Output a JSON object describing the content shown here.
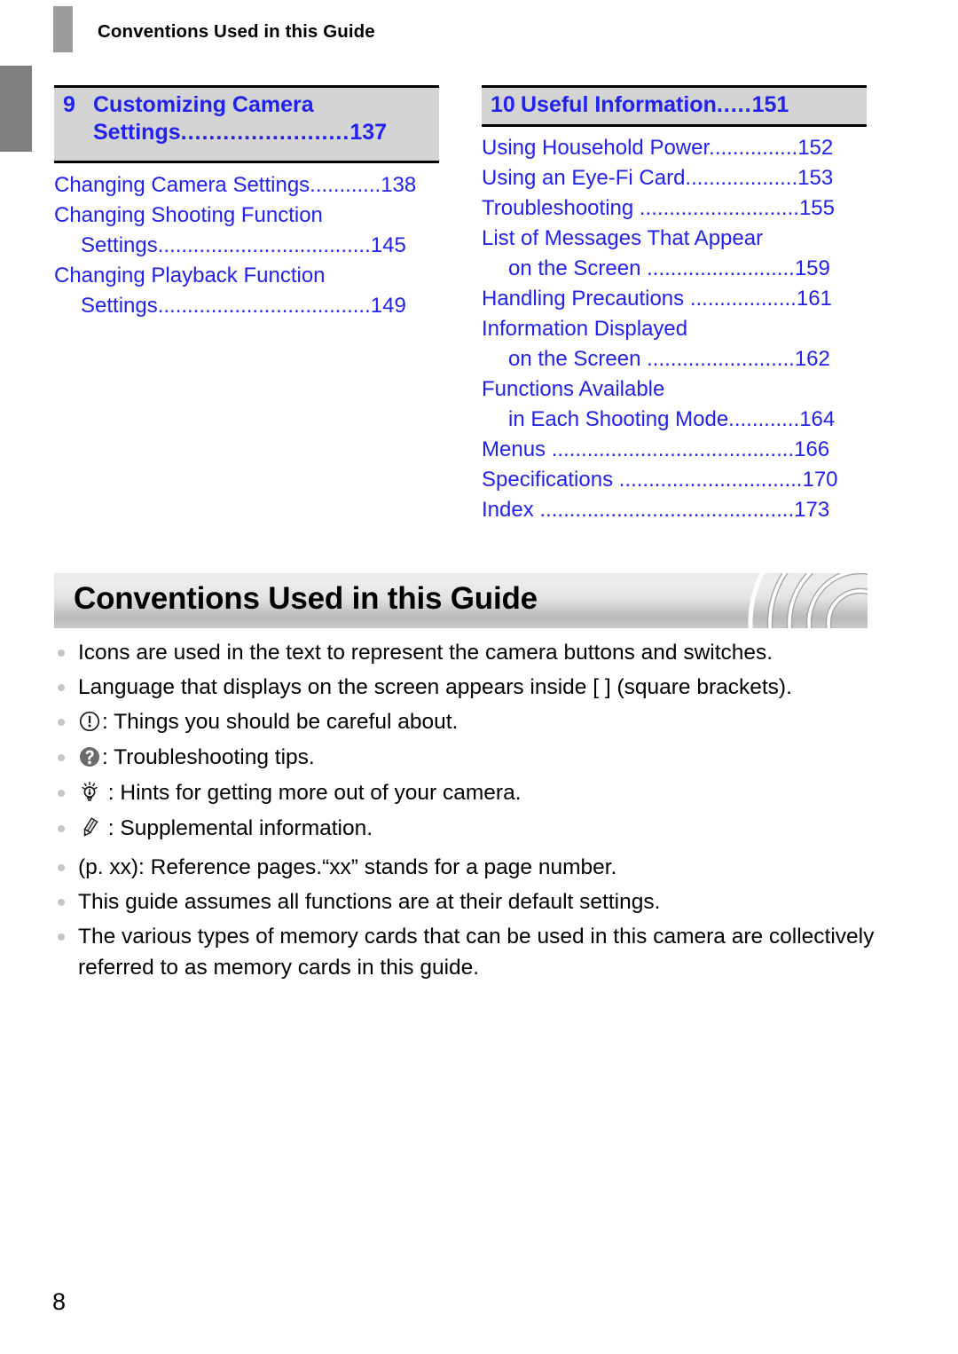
{
  "header": {
    "title": "Conventions Used in this Guide",
    "marker_icon": "chapter-marker-bar"
  },
  "edge_tab": {
    "icon": "chapter-edge-tab"
  },
  "toc": {
    "columns": [
      {
        "chapter": {
          "number": "9",
          "title_line1": "Customizing Camera",
          "title_line2": "Settings",
          "leader": "........................",
          "page": "137"
        },
        "entries": [
          {
            "label": "Changing Camera Settings",
            "leader": "............",
            "page": "138",
            "sub": false
          },
          {
            "label": "Changing Shooting Function",
            "leader": "",
            "page": "",
            "sub": false
          },
          {
            "label": "Settings",
            "leader": "....................................",
            "page": "145",
            "sub": true
          },
          {
            "label": "Changing Playback Function",
            "leader": "",
            "page": "",
            "sub": false
          },
          {
            "label": "Settings",
            "leader": "....................................",
            "page": "149",
            "sub": true
          }
        ]
      },
      {
        "chapter": {
          "number": "10",
          "title_line1": "Useful Information",
          "title_line2": "",
          "leader": ".....",
          "page": "151"
        },
        "entries": [
          {
            "label": "Using Household Power",
            "leader": "...............",
            "page": "152",
            "sub": false
          },
          {
            "label": "Using an Eye-Fi Card",
            "leader": "...................",
            "page": "153",
            "sub": false
          },
          {
            "label": "Troubleshooting ",
            "leader": "...........................",
            "page": "155",
            "sub": false
          },
          {
            "label": "List of Messages That Appear",
            "leader": "",
            "page": "",
            "sub": false
          },
          {
            "label": "on the Screen ",
            "leader": ".........................",
            "page": "159",
            "sub": true
          },
          {
            "label": "Handling Precautions ",
            "leader": "..................",
            "page": "161",
            "sub": false
          },
          {
            "label": "Information Displayed",
            "leader": "",
            "page": "",
            "sub": false
          },
          {
            "label": "on the Screen ",
            "leader": ".........................",
            "page": "162",
            "sub": true
          },
          {
            "label": "Functions Available",
            "leader": "",
            "page": "",
            "sub": false
          },
          {
            "label": "in Each Shooting Mode",
            "leader": "............",
            "page": "164",
            "sub": true
          },
          {
            "label": "Menus ",
            "leader": ".........................................",
            "page": "166",
            "sub": false
          },
          {
            "label": "Specifications ",
            "leader": "...............................",
            "page": "170",
            "sub": false
          },
          {
            "label": "Index ",
            "leader": "...........................................",
            "page": "173",
            "sub": false
          }
        ]
      }
    ]
  },
  "section": {
    "banner_title": "Conventions Used in this Guide",
    "banner_decoration_icon": "concentric-arcs-decoration"
  },
  "body": {
    "items": [
      {
        "icon": "",
        "text": "Icons are used in the text to represent the camera buttons and switches."
      },
      {
        "icon": "",
        "text": "Language that displays on the screen appears inside [ ] (square brackets)."
      },
      {
        "icon": "exclamation-circle-icon",
        "text": ": Things you should be careful about."
      },
      {
        "icon": "question-circle-icon",
        "text": ": Troubleshooting tips."
      },
      {
        "icon": "lightbulb-icon",
        "text": " : Hints for getting more out of your camera."
      },
      {
        "icon": "pencil-icon",
        "text": " : Supplemental information."
      },
      {
        "icon": "",
        "text": "(p. xx): Reference pages.“xx” stands for a page number."
      },
      {
        "icon": "",
        "text": "This guide assumes all functions are at their default settings."
      },
      {
        "icon": "",
        "text": "The various types of memory cards that can be used in this camera are collectively referred to as memory cards in this guide."
      }
    ]
  },
  "folio": {
    "page_number": "8"
  },
  "colors": {
    "toc_link": "#2222ee",
    "chapter_box_fill": "#d4d4d4",
    "edge_tab": "#808080",
    "bullet": "#c6c6c6",
    "banner_gradient_light": "#ededed",
    "banner_gradient_dark": "#b9b9b9"
  }
}
